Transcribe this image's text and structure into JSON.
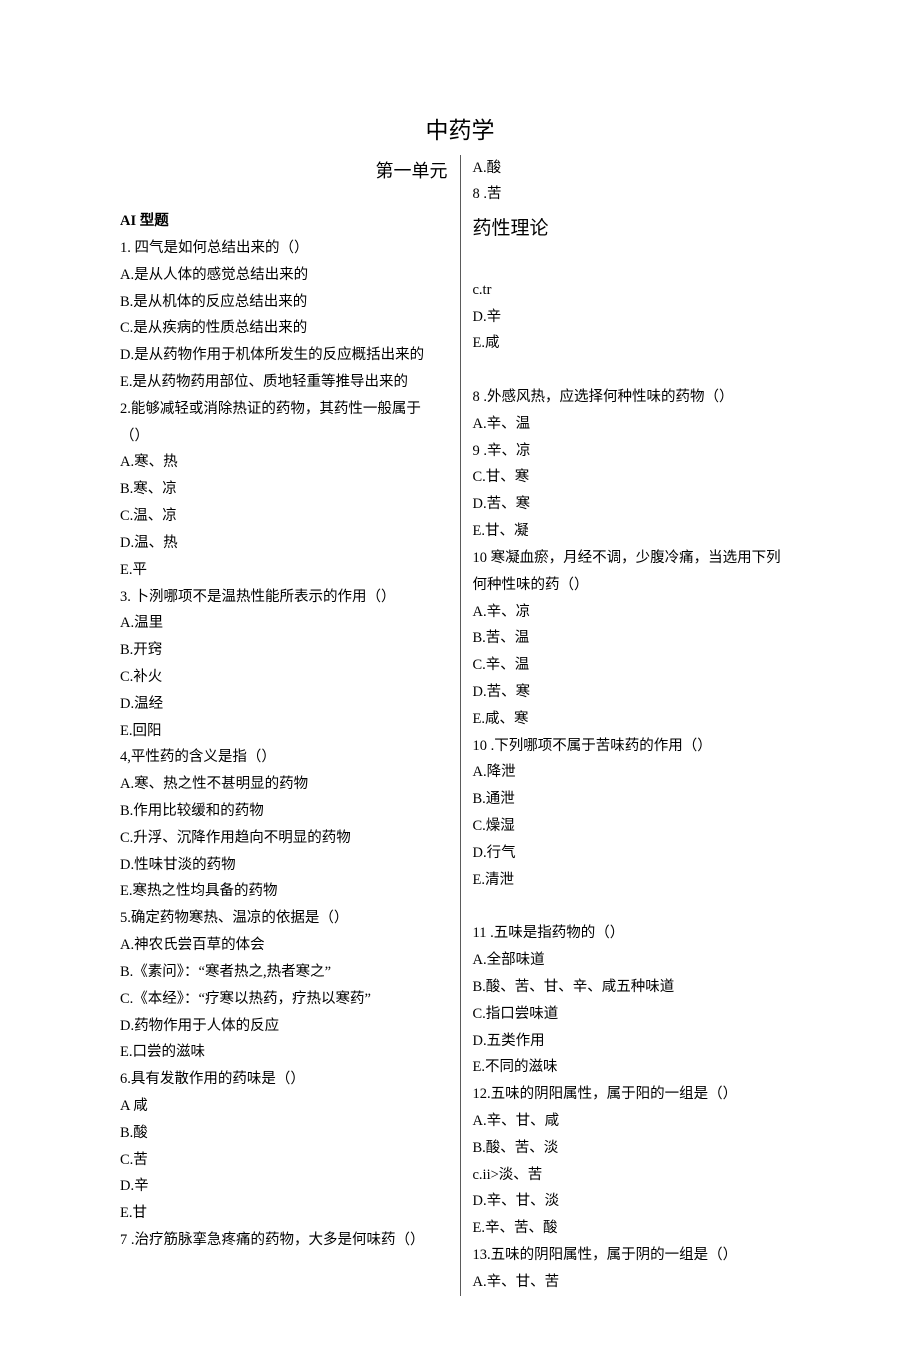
{
  "title": "中药学",
  "unit_label": "第一单元",
  "header_right_1": "A.酸",
  "header_right_2": "8 .苦",
  "section_heading": "AI 型题",
  "yaoxing": "药性理论",
  "left_lines": [
    "1. 四气是如何总结出来的（）",
    "A.是从人体的感觉总结出来的",
    "B.是从机体的反应总结出来的",
    "C.是从疾病的性质总结出来的",
    "D.是从药物作用于机体所发生的反应概括出来的",
    "E.是从药物药用部位、质地轻重等推导出来的",
    "2.能够减轻或消除热证的药物，其药性一般属于",
    "（）",
    "A.寒、热",
    "B.寒、凉",
    "C.温、凉",
    "D.温、热",
    "E.平",
    "3. 卜洌哪项不是温热性能所表示的作用（）",
    "A.温里",
    "B.开窍",
    "C.补火",
    "D.温经",
    "E.回阳",
    "4,平性药的含义是指（）",
    "A.寒、热之性不甚明显的药物",
    "B.作用比较缓和的药物",
    "C.升浮、沉降作用趋向不明显的药物",
    "D.性味甘淡的药物",
    "E.寒热之性均具备的药物",
    "5.确定药物寒热、温凉的依据是（）",
    "A.神农氏尝百草的体会",
    "B.《素问》：“寒者热之,热者寒之”",
    "C.《本经》：“疗寒以热药，疗热以寒药”",
    "D.药物作用于人体的反应",
    "E.口尝的滋味",
    "6.具有发散作用的药味是（）",
    "A 咸",
    "B.酸",
    "C.苦",
    "D.辛",
    "E.甘",
    "7 .治疗筋脉挛急疼痛的药物，大多是何味药（）"
  ],
  "right_lines": [
    "c.tr",
    "D.辛",
    "E.咸",
    "",
    "8 .外感风热，应选择何种性味的药物（）",
    "A.辛、温",
    "9 .辛、凉",
    "C.甘、寒",
    "D.苦、寒",
    "E.甘、凝",
    "10 寒凝血瘀，月经不调，少腹冷痛，当选用下列",
    "何种性味的药（）",
    "A.辛、凉",
    "B.苦、温",
    "C.辛、温",
    "D.苦、寒",
    "E.咸、寒",
    "10 .下列哪项不属于苦味药的作用（）",
    "A.降泄",
    "B.通泄",
    "C.燥湿",
    "D.行气",
    "E.清泄",
    "",
    "11 .五味是指药物的（）",
    "A.全部味道",
    "B.酸、苦、甘、辛、咸五种味道",
    "C.指口尝味道",
    "D.五类作用",
    "E.不同的滋味",
    "12.五味的阴阳属性，属于阳的一组是（）",
    "A.辛、甘、咸",
    "B.酸、苦、淡",
    "c.ii>淡、苦",
    "D.辛、甘、淡",
    "E.辛、苦、酸",
    "13.五味的阴阳属性，属于阴的一组是（）",
    "A.辛、甘、苦"
  ]
}
